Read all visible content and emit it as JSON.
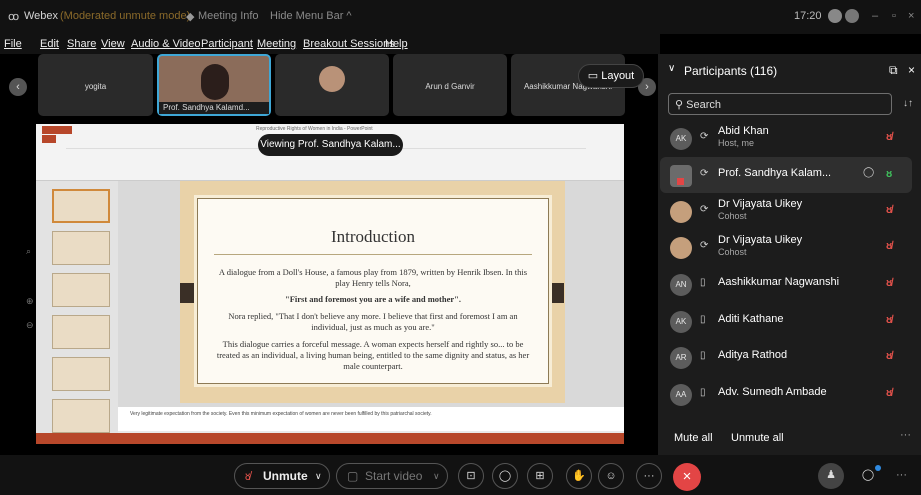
{
  "titlebar": {
    "app": "Webex",
    "mode": "(Moderated unmute mode)",
    "meeting_info": "Meeting Info",
    "hide_menu": "Hide Menu Bar ^",
    "time": "17:20"
  },
  "menu": [
    "File",
    "Edit",
    "Share",
    "View",
    "Audio & Video",
    "Participant",
    "Meeting",
    "Breakout Sessions",
    "Help"
  ],
  "filmstrip": {
    "tiles": [
      "yogita",
      "Prof. Sandhya Kalamd...",
      "",
      "Arun d Ganvir",
      "Aashikkumar Nagwanshi"
    ],
    "layout_label": "Layout"
  },
  "share": {
    "viewing_label": "Viewing Prof. Sandhya Kalam...",
    "ppt_title": "Reproductive Rights of Women in India - PowerPoint",
    "slide": {
      "title": "Introduction",
      "p1": "A dialogue from a Doll's House, a famous play from 1879, written by Henrik Ibsen. In this play Henry tells Nora,",
      "p2": "\"First and foremost you are a wife and mother\".",
      "p3": "Nora replied, \"That I don't believe any more. I believe that first and foremost I am an individual, just as much as you are.\"",
      "p4": "This dialogue carries a forceful message. A woman expects herself and rightly so... to be treated as an individual, a living human being, entitled to the same dignity and status, as her male counterpart."
    },
    "notes": "Very legitimate expectation from the society. Even this minimum expectation of women are never been fulfilled by this patriarchal society."
  },
  "participants": {
    "header": "Participants (116)",
    "search_placeholder": "Search",
    "list": [
      {
        "initials": "AK",
        "name": "Abid Khan",
        "sub": "Host, me"
      },
      {
        "initials": "",
        "name": "Prof. Sandhya Kalam...",
        "sub": ""
      },
      {
        "initials": "",
        "name": "Dr Vijayata Uikey",
        "sub": "Cohost"
      },
      {
        "initials": "",
        "name": "Dr Vijayata Uikey",
        "sub": "Cohost"
      },
      {
        "initials": "AN",
        "name": "Aashikkumar Nagwanshi",
        "sub": ""
      },
      {
        "initials": "AK",
        "name": "Aditi Kathane",
        "sub": ""
      },
      {
        "initials": "AR",
        "name": "Aditya Rathod",
        "sub": ""
      },
      {
        "initials": "AA",
        "name": "Adv. Sumedh Ambade",
        "sub": ""
      }
    ],
    "mute_all": "Mute all",
    "unmute_all": "Unmute all"
  },
  "controls": {
    "unmute": "Unmute",
    "start_video": "Start video"
  }
}
